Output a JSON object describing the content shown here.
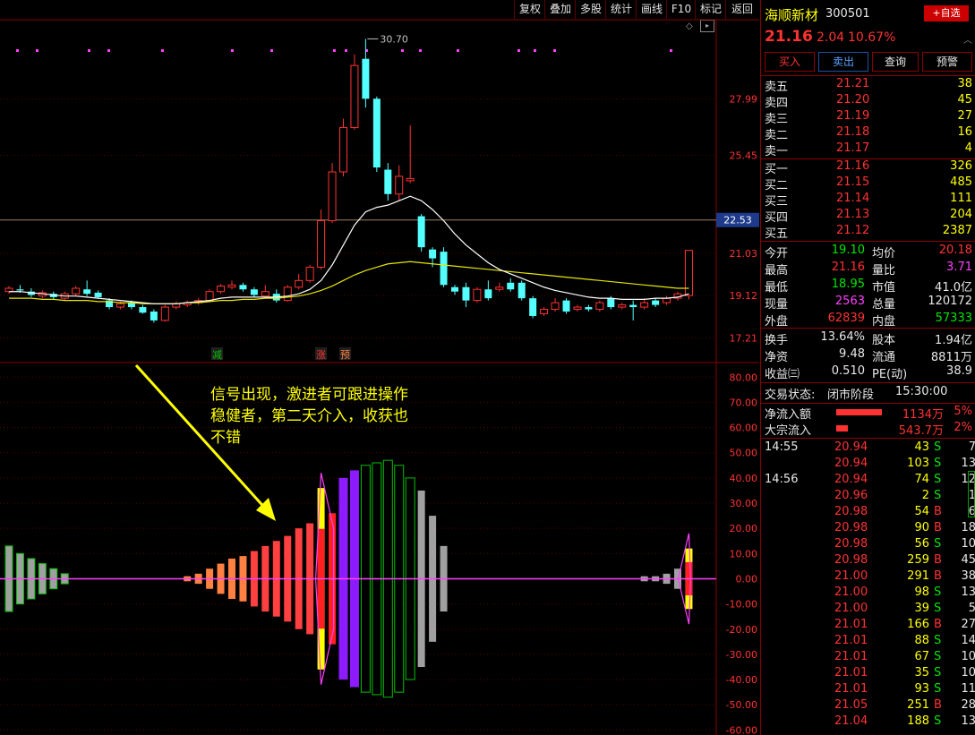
{
  "toolbar": {
    "items": [
      "复权",
      "叠加",
      "多股",
      "统计",
      "画线",
      "F10",
      "标记",
      "返回"
    ]
  },
  "kline": {
    "price_ticks": [
      "27.99",
      "25.45",
      "21.03",
      "19.12",
      "17.21"
    ],
    "current_price_marker": "22.53",
    "peak_label": "30.70",
    "signals": [
      "减",
      "涨",
      "预"
    ]
  },
  "indicator": {
    "annotation_lines": [
      "信号出现，激进者可跟进操作",
      "稳健者，第二天介入，收获也",
      "不错"
    ],
    "y_ticks": [
      "80.00",
      "70.00",
      "60.00",
      "50.00",
      "40.00",
      "30.00",
      "20.00",
      "10.00",
      "0.00",
      "-10.00",
      "-20.00",
      "-30.00",
      "-40.00",
      "-50.00",
      "-60.00"
    ]
  },
  "stock": {
    "name": "海顺新材",
    "code": "300501",
    "watch_button": "+自选",
    "price": "21.16",
    "change": "2.04",
    "change_pct": "10.67%",
    "buy_label": "买入",
    "sell_label": "卖出",
    "query_label": "查询",
    "alert_label": "预警"
  },
  "order_book": {
    "asks": [
      {
        "label": "卖五",
        "price": "21.21",
        "vol": "38"
      },
      {
        "label": "卖四",
        "price": "21.20",
        "vol": "45"
      },
      {
        "label": "卖三",
        "price": "21.19",
        "vol": "27"
      },
      {
        "label": "卖二",
        "price": "21.18",
        "vol": "16"
      },
      {
        "label": "卖一",
        "price": "21.17",
        "vol": "4"
      }
    ],
    "bids": [
      {
        "label": "买一",
        "price": "21.16",
        "vol": "326"
      },
      {
        "label": "买二",
        "price": "21.15",
        "vol": "485"
      },
      {
        "label": "买三",
        "price": "21.14",
        "vol": "111"
      },
      {
        "label": "买四",
        "price": "21.13",
        "vol": "204"
      },
      {
        "label": "买五",
        "price": "21.12",
        "vol": "2387"
      }
    ]
  },
  "stats": {
    "open_label": "今开",
    "open": "19.10",
    "avg_label": "均价",
    "avg": "20.18",
    "high_label": "最高",
    "high": "21.16",
    "vol_ratio_label": "量比",
    "vol_ratio": "3.71",
    "low_label": "最低",
    "low": "18.95",
    "mktcap_label": "市值",
    "mktcap": "41.0亿",
    "cur_label": "现量",
    "cur": "2563",
    "totvol_label": "总量",
    "totvol": "120172",
    "outer_label": "外盘",
    "outer": "62839",
    "inner_label": "内盘",
    "inner": "57333",
    "turnover_label": "换手",
    "turnover": "13.64%",
    "equity_label": "股本",
    "equity": "1.94亿",
    "nav_label": "净资",
    "nav": "9.48",
    "float_label": "流通",
    "float": "8811万",
    "eps_label": "收益㈢",
    "eps": "0.510",
    "pe_label": "PE(动)",
    "pe": "38.9"
  },
  "status": {
    "label": "交易状态:",
    "state": "闭市阶段",
    "time": "15:30:00"
  },
  "flows": [
    {
      "label": "净流入额",
      "value": "1134万",
      "pct": "5%",
      "bar": 0.6
    },
    {
      "label": "大宗流入",
      "value": "543.7万",
      "pct": "2%",
      "bar": 0.15
    }
  ],
  "ticks": [
    {
      "time": "14:55",
      "price": "20.94",
      "vol": "43",
      "bs": "S",
      "n": "7"
    },
    {
      "time": "",
      "price": "20.94",
      "vol": "103",
      "bs": "S",
      "n": "13"
    },
    {
      "time": "14:56",
      "price": "20.94",
      "vol": "74",
      "bs": "S",
      "n": "12"
    },
    {
      "time": "",
      "price": "20.96",
      "vol": "2",
      "bs": "S",
      "n": "1"
    },
    {
      "time": "",
      "price": "20.98",
      "vol": "54",
      "bs": "B",
      "n": "6"
    },
    {
      "time": "",
      "price": "20.98",
      "vol": "90",
      "bs": "B",
      "n": "18"
    },
    {
      "time": "",
      "price": "20.98",
      "vol": "56",
      "bs": "S",
      "n": "10"
    },
    {
      "time": "",
      "price": "20.98",
      "vol": "259",
      "bs": "B",
      "n": "45"
    },
    {
      "time": "",
      "price": "21.00",
      "vol": "291",
      "bs": "B",
      "n": "38"
    },
    {
      "time": "",
      "price": "21.00",
      "vol": "98",
      "bs": "S",
      "n": "13"
    },
    {
      "time": "",
      "price": "21.00",
      "vol": "39",
      "bs": "S",
      "n": "5"
    },
    {
      "time": "",
      "price": "21.01",
      "vol": "166",
      "bs": "B",
      "n": "27"
    },
    {
      "time": "",
      "price": "21.01",
      "vol": "88",
      "bs": "S",
      "n": "14"
    },
    {
      "time": "",
      "price": "21.01",
      "vol": "67",
      "bs": "S",
      "n": "10"
    },
    {
      "time": "",
      "price": "21.01",
      "vol": "35",
      "bs": "S",
      "n": "10"
    },
    {
      "time": "",
      "price": "21.01",
      "vol": "93",
      "bs": "S",
      "n": "11"
    },
    {
      "time": "",
      "price": "21.05",
      "vol": "251",
      "bs": "B",
      "n": "28"
    },
    {
      "time": "",
      "price": "21.04",
      "vol": "188",
      "bs": "S",
      "n": "13"
    }
  ],
  "chart_data": {
    "type": "candlestick",
    "price_range": [
      16.3,
      31.0
    ],
    "candles": [
      [
        19.3,
        19.45,
        19.55,
        19.2
      ],
      [
        19.4,
        19.35,
        19.6,
        19.25
      ],
      [
        19.3,
        19.15,
        19.45,
        19.05
      ],
      [
        19.1,
        19.25,
        19.35,
        19.0
      ],
      [
        19.2,
        19.05,
        19.3,
        18.95
      ],
      [
        19.0,
        19.2,
        19.3,
        18.9
      ],
      [
        19.2,
        19.45,
        19.55,
        19.1
      ],
      [
        19.4,
        19.2,
        19.8,
        19.1
      ],
      [
        19.25,
        19.05,
        19.35,
        19.0
      ],
      [
        18.9,
        18.6,
        19.0,
        18.5
      ],
      [
        18.6,
        18.75,
        18.85,
        18.5
      ],
      [
        18.8,
        18.6,
        18.9,
        18.5
      ],
      [
        18.6,
        18.35,
        18.7,
        18.3
      ],
      [
        18.4,
        18.0,
        18.5,
        17.9
      ],
      [
        18.0,
        18.6,
        18.7,
        17.95
      ],
      [
        18.6,
        18.75,
        18.85,
        18.5
      ],
      [
        18.7,
        18.8,
        18.9,
        18.6
      ],
      [
        18.8,
        18.9,
        19.0,
        18.7
      ],
      [
        18.9,
        19.3,
        19.4,
        18.85
      ],
      [
        19.3,
        19.55,
        19.65,
        19.2
      ],
      [
        19.5,
        19.6,
        19.8,
        19.4
      ],
      [
        19.6,
        19.4,
        19.7,
        19.3
      ],
      [
        19.4,
        19.15,
        19.5,
        19.05
      ],
      [
        19.1,
        19.3,
        19.6,
        19.0
      ],
      [
        19.2,
        18.9,
        19.4,
        18.8
      ],
      [
        18.9,
        19.5,
        19.6,
        18.85
      ],
      [
        19.5,
        19.8,
        20.1,
        19.4
      ],
      [
        19.8,
        20.4,
        20.5,
        19.7
      ],
      [
        20.4,
        22.5,
        23.0,
        20.3
      ],
      [
        22.5,
        24.7,
        25.1,
        22.4
      ],
      [
        24.7,
        26.7,
        27.1,
        24.5
      ],
      [
        26.7,
        29.5,
        30.0,
        26.6
      ],
      [
        29.8,
        28.0,
        30.7,
        27.6
      ],
      [
        28.0,
        24.9,
        28.1,
        24.7
      ],
      [
        24.8,
        23.7,
        25.1,
        23.4
      ],
      [
        23.7,
        24.5,
        25.0,
        23.4
      ],
      [
        24.3,
        24.4,
        26.8,
        24.2
      ],
      [
        22.7,
        21.3,
        22.8,
        21.1
      ],
      [
        21.2,
        20.8,
        21.3,
        20.4
      ],
      [
        21.1,
        19.6,
        21.3,
        19.5
      ],
      [
        19.5,
        19.3,
        19.6,
        19.15
      ],
      [
        19.5,
        18.9,
        19.7,
        18.6
      ],
      [
        18.9,
        19.4,
        19.5,
        18.8
      ],
      [
        19.4,
        19.0,
        19.8,
        18.9
      ],
      [
        19.4,
        19.5,
        19.7,
        19.3
      ],
      [
        19.7,
        19.4,
        19.9,
        19.3
      ],
      [
        19.7,
        19.0,
        19.8,
        18.9
      ],
      [
        19.0,
        18.2,
        19.1,
        18.1
      ],
      [
        18.3,
        18.5,
        18.6,
        18.2
      ],
      [
        18.5,
        18.8,
        19.0,
        18.4
      ],
      [
        18.9,
        18.4,
        19.0,
        18.3
      ],
      [
        18.5,
        18.6,
        18.7,
        18.4
      ],
      [
        18.6,
        18.5,
        18.7,
        18.4
      ],
      [
        18.5,
        18.8,
        18.9,
        18.4
      ],
      [
        19.0,
        18.6,
        19.1,
        18.5
      ],
      [
        18.6,
        18.7,
        18.8,
        18.5
      ],
      [
        18.7,
        18.6,
        18.9,
        18.0
      ],
      [
        18.6,
        18.8,
        19.0,
        18.5
      ],
      [
        18.9,
        18.7,
        19.0,
        18.6
      ],
      [
        18.8,
        19.0,
        19.1,
        18.7
      ],
      [
        19.0,
        19.2,
        19.3,
        18.9
      ],
      [
        19.12,
        21.16,
        21.16,
        18.95
      ]
    ],
    "ma_fast": [
      19.3,
      19.3,
      19.25,
      19.2,
      19.15,
      19.1,
      19.1,
      19.05,
      19.0,
      18.95,
      18.9,
      18.85,
      18.8,
      18.75,
      18.75,
      18.75,
      18.8,
      18.85,
      18.9,
      19.0,
      19.05,
      19.05,
      19.05,
      19.05,
      19.05,
      19.1,
      19.2,
      19.4,
      19.8,
      20.5,
      21.4,
      22.3,
      22.9,
      23.1,
      23.2,
      23.4,
      23.6,
      23.4,
      23.0,
      22.5,
      21.9,
      21.4,
      21.0,
      20.6,
      20.3,
      20.1,
      19.9,
      19.7,
      19.5,
      19.35,
      19.25,
      19.15,
      19.05,
      19.0,
      19.0,
      18.95,
      18.95,
      18.95,
      19.0,
      19.0,
      19.05,
      19.2
    ],
    "ma_slow": [
      19.0,
      19.0,
      19.0,
      18.95,
      18.95,
      18.9,
      18.9,
      18.9,
      18.85,
      18.85,
      18.8,
      18.8,
      18.75,
      18.75,
      18.75,
      18.75,
      18.8,
      18.8,
      18.85,
      18.9,
      18.9,
      18.95,
      18.95,
      19.0,
      19.0,
      19.05,
      19.1,
      19.2,
      19.35,
      19.55,
      19.8,
      20.05,
      20.25,
      20.4,
      20.55,
      20.6,
      20.65,
      20.6,
      20.55,
      20.5,
      20.45,
      20.4,
      20.35,
      20.3,
      20.25,
      20.2,
      20.15,
      20.1,
      20.05,
      20.0,
      19.95,
      19.9,
      19.85,
      19.8,
      19.75,
      19.7,
      19.65,
      19.6,
      19.55,
      19.5,
      19.45,
      19.45
    ],
    "oscillator": [
      [
        -13,
        13
      ],
      [
        -10,
        10
      ],
      [
        -8,
        8
      ],
      [
        -6,
        6
      ],
      [
        -4,
        4
      ],
      [
        -2,
        2
      ],
      [
        0,
        0
      ],
      [
        0,
        0
      ],
      [
        0,
        0
      ],
      [
        0,
        0
      ],
      [
        0,
        0
      ],
      [
        0,
        0
      ],
      [
        0,
        0
      ],
      [
        0,
        0
      ],
      [
        0,
        0
      ],
      [
        0,
        0
      ],
      [
        -1,
        1
      ],
      [
        -2,
        2
      ],
      [
        -4,
        4
      ],
      [
        -6,
        6
      ],
      [
        -8,
        8
      ],
      [
        -9,
        9
      ],
      [
        -11,
        11
      ],
      [
        -13,
        13
      ],
      [
        -15,
        15
      ],
      [
        -17,
        17
      ],
      [
        -20,
        20
      ],
      [
        -22,
        22
      ],
      [
        -36,
        36
      ],
      [
        -26,
        26
      ],
      [
        -40,
        40
      ],
      [
        -43,
        43
      ],
      [
        -45,
        45
      ],
      [
        -46,
        46
      ],
      [
        -47,
        47
      ],
      [
        -45,
        45
      ],
      [
        -40,
        40
      ],
      [
        -35,
        35
      ],
      [
        -25,
        25
      ],
      [
        -13,
        13
      ],
      [
        0,
        0
      ],
      [
        0,
        0
      ],
      [
        0,
        0
      ],
      [
        0,
        0
      ],
      [
        0,
        0
      ],
      [
        0,
        0
      ],
      [
        0,
        0
      ],
      [
        0,
        0
      ],
      [
        0,
        0
      ],
      [
        0,
        0
      ],
      [
        0,
        0
      ],
      [
        0,
        0
      ],
      [
        0,
        0
      ],
      [
        0,
        0
      ],
      [
        0,
        0
      ],
      [
        0,
        0
      ],
      [
        0,
        0
      ],
      [
        -1,
        1
      ],
      [
        -1,
        1
      ],
      [
        -2,
        2
      ],
      [
        -4,
        4
      ],
      [
        -12,
        12
      ]
    ],
    "osc_range": [
      -62,
      84
    ]
  }
}
